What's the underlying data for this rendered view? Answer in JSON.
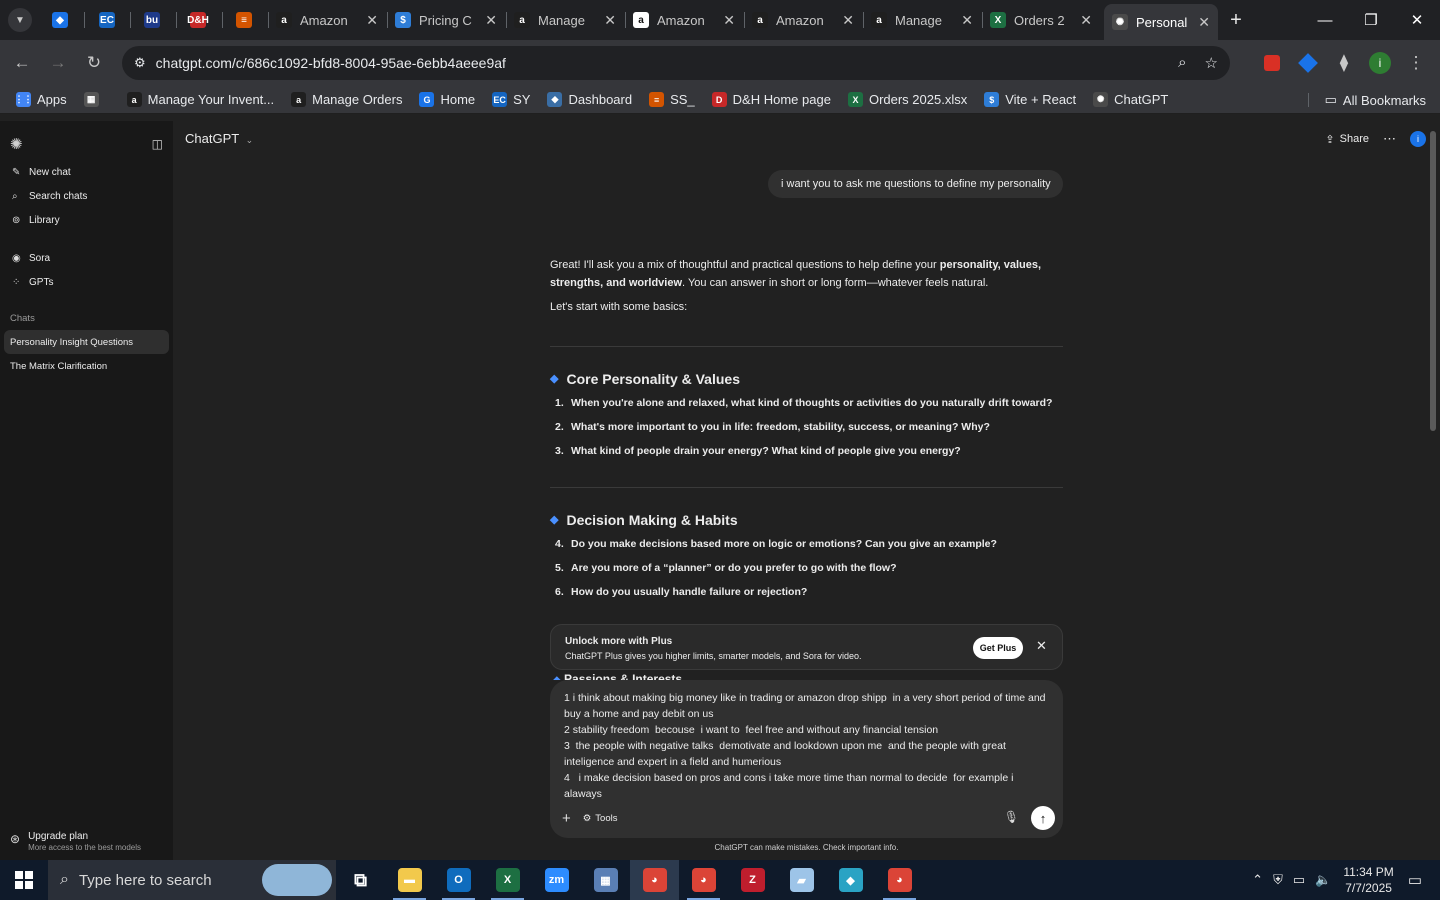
{
  "browser": {
    "tabs": [
      {
        "title": "",
        "favicon": "nav-blue-icon",
        "color": "#1a73e8",
        "glyph": "◆"
      },
      {
        "title": "",
        "favicon": "ec-icon",
        "color": "#1565c0",
        "glyph": "EC"
      },
      {
        "title": "",
        "favicon": "bu-icon",
        "color": "#1e3a8a",
        "glyph": "bu"
      },
      {
        "title": "",
        "favicon": "dh-icon",
        "color": "#c62828",
        "glyph": "D&H"
      },
      {
        "title": "",
        "favicon": "stack-icon",
        "color": "#d35400",
        "glyph": "≡"
      },
      {
        "title": "Amazon",
        "favicon": "amazon-icon",
        "color": "#1f1f1f",
        "glyph": "a"
      },
      {
        "title": "Pricing C",
        "favicon": "dollar-icon",
        "color": "#2e7dd7",
        "glyph": "$"
      },
      {
        "title": "Manage",
        "favicon": "amazon-icon",
        "color": "#1f1f1f",
        "glyph": "a"
      },
      {
        "title": "Amazon",
        "favicon": "amazon-icon",
        "color": "#ffffff",
        "glyph": "a"
      },
      {
        "title": "Amazon",
        "favicon": "amazon-icon",
        "color": "#1f1f1f",
        "glyph": "a"
      },
      {
        "title": "Manage",
        "favicon": "amazon-icon",
        "color": "#1f1f1f",
        "glyph": "a"
      },
      {
        "title": "Orders 2",
        "favicon": "excel-icon",
        "color": "#1d6f42",
        "glyph": "X"
      },
      {
        "title": "Personal",
        "favicon": "chatgpt-icon",
        "color": "#4a4a4a",
        "glyph": "✺"
      }
    ],
    "new_tab": "+",
    "window_controls": {
      "minimize": "—",
      "restore": "❐",
      "close": "✕"
    },
    "url": "chatgpt.com/c/686c1092-bfd8-8004-95ae-6ebb4aeee9af",
    "profile_initial": "i",
    "bookmarks": [
      {
        "label": "Apps",
        "icon": "apps-grid-icon",
        "color": "#4285f4",
        "glyph": "⋮⋮"
      },
      {
        "label": "",
        "icon": "tab-groups-icon",
        "color": "#555",
        "glyph": "▦"
      },
      {
        "label": "Manage Your Invent...",
        "icon": "amazon-icon",
        "color": "#1f1f1f",
        "glyph": "a"
      },
      {
        "label": "Manage Orders",
        "icon": "amazon-icon",
        "color": "#1f1f1f",
        "glyph": "a"
      },
      {
        "label": "Home",
        "icon": "home-g-icon",
        "color": "#1a73e8",
        "glyph": "G"
      },
      {
        "label": "SY",
        "icon": "ec-icon",
        "color": "#1565c0",
        "glyph": "EC"
      },
      {
        "label": "Dashboard",
        "icon": "dashboard-icon",
        "color": "#3a6ea5",
        "glyph": "◆"
      },
      {
        "label": "SS_",
        "icon": "stack-icon",
        "color": "#d35400",
        "glyph": "≡"
      },
      {
        "label": "D&H Home page",
        "icon": "dh-icon",
        "color": "#c62828",
        "glyph": "D"
      },
      {
        "label": "Orders 2025.xlsx",
        "icon": "excel-icon",
        "color": "#1d6f42",
        "glyph": "X"
      },
      {
        "label": "Vite + React",
        "icon": "dollar-icon",
        "color": "#2e7dd7",
        "glyph": "$"
      },
      {
        "label": "ChatGPT",
        "icon": "chatgpt-icon",
        "color": "#4a4a4a",
        "glyph": "✺"
      }
    ],
    "all_bookmarks": "All Bookmarks"
  },
  "sidebar": {
    "nav": [
      {
        "label": "New chat",
        "icon": "edit-icon",
        "glyph": "✎"
      },
      {
        "label": "Search chats",
        "icon": "search-icon",
        "glyph": "⌕"
      },
      {
        "label": "Library",
        "icon": "library-icon",
        "glyph": "⊚"
      }
    ],
    "extras": [
      {
        "label": "Sora",
        "icon": "sora-icon",
        "glyph": "◉"
      },
      {
        "label": "GPTs",
        "icon": "gpts-icon",
        "glyph": "⁘"
      }
    ],
    "chats_header": "Chats",
    "chats": [
      {
        "label": "Personality Insight Questions",
        "selected": true
      },
      {
        "label": "The Matrix Clarification",
        "selected": false
      }
    ],
    "upgrade": {
      "title": "Upgrade plan",
      "subtitle": "More access to the best models"
    }
  },
  "main": {
    "model": "ChatGPT",
    "share": "Share",
    "user_message": "i want you to ask me questions to define my personality",
    "answer": {
      "intro_parts": [
        "Great! I'll ask you a mix of thoughtful and practical questions to help define your ",
        "personality, values, strengths, and worldview",
        ". You can answer in short or long form—whatever feels natural."
      ],
      "lead": "Let's start with some basics:",
      "sections": [
        {
          "title": "Core Personality & Values",
          "questions": [
            {
              "n": "1.",
              "text": "When you're alone and relaxed, what kind of thoughts or activities do you naturally drift toward?"
            },
            {
              "n": "2.",
              "text": "What's more important to you in life: freedom, stability, success, or meaning? Why?"
            },
            {
              "n": "3.",
              "text": "What kind of people drain your energy? What kind of people give you energy?"
            }
          ]
        },
        {
          "title": "Decision Making & Habits",
          "questions": [
            {
              "n": "4.",
              "text": "Do you make decisions based more on logic or emotions? Can you give an example?"
            },
            {
              "n": "5.",
              "text": "Are you more of a “planner” or do you prefer to go with the flow?"
            },
            {
              "n": "6.",
              "text": "How do you usually handle failure or rejection?"
            }
          ]
        }
      ],
      "next_section_peek": "Passions & Interests"
    },
    "plus_banner": {
      "title": "Unlock more with Plus",
      "text": "ChatGPT Plus gives you higher limits, smarter models, and Sora for video.",
      "button": "Get Plus"
    },
    "composer": {
      "lines": [
        "1 i think about making big money like in trading or amazon drop shipp  in a very short period of time and buy a home and pay debit on us",
        "2 stability freedom  becouse  i want to  feel free and without any financial tension",
        "3  the people with negative talks  demotivate and lookdown upon me  and the people with great inteligence and expert in a field and humerious",
        "4   i make decision based on pros and cons i take more time than normal to decide  for example i alaways"
      ],
      "tools": "Tools"
    },
    "disclaimer": "ChatGPT can make mistakes. Check important info."
  },
  "taskbar": {
    "search_placeholder": "Type here to search",
    "apps": [
      {
        "name": "task-view-icon",
        "glyph": "⧉",
        "color": "#ffffff",
        "state": ""
      },
      {
        "name": "file-explorer-icon",
        "glyph": "▬",
        "color": "#f2c94c",
        "state": "run"
      },
      {
        "name": "outlook-icon",
        "glyph": "O",
        "color": "#0f6cbd",
        "state": "run"
      },
      {
        "name": "excel-icon",
        "glyph": "X",
        "color": "#1d6f42",
        "state": "run"
      },
      {
        "name": "zoom-icon",
        "glyph": "zm",
        "color": "#2d8cff",
        "state": ""
      },
      {
        "name": "calculator-icon",
        "glyph": "▦",
        "color": "#5a7fb5",
        "state": ""
      },
      {
        "name": "chrome-icon",
        "glyph": "◕",
        "color": "#db4437",
        "state": "active"
      },
      {
        "name": "chrome-icon-2",
        "glyph": "◕",
        "color": "#db4437",
        "state": "run"
      },
      {
        "name": "filezilla-icon",
        "glyph": "Z",
        "color": "#bf1e2d",
        "state": ""
      },
      {
        "name": "notes-icon",
        "glyph": "▰",
        "color": "#9dc4e8",
        "state": ""
      },
      {
        "name": "vpn-icon",
        "glyph": "◆",
        "color": "#2aa3c4",
        "state": ""
      },
      {
        "name": "chrome-icon-3",
        "glyph": "◕",
        "color": "#db4437",
        "state": "run"
      }
    ],
    "time": "11:34 PM",
    "date": "7/7/2025"
  }
}
